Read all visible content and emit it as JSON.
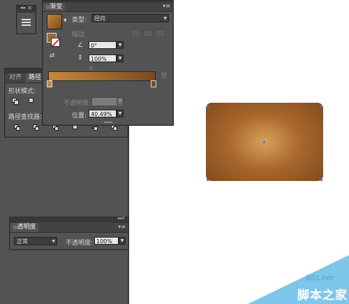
{
  "gradient_panel": {
    "title": "渐变",
    "type_label": "类型:",
    "type_value": "径向",
    "stroke_label": "描边",
    "angle_value": "0°",
    "aspect_value": "100%",
    "opacity_label": "不透明度:",
    "opacity_value": "",
    "location_label": "位置:",
    "location_value": "40.49%",
    "gradient_colors": {
      "start": "#c4883e",
      "end": "#7a4a1f"
    }
  },
  "pathfinder_panel": {
    "tab_align": "对齐",
    "tab_pathfinder": "路径",
    "shape_modes_label": "形状模式:",
    "pathfinders_label": "路径查找器:"
  },
  "transparency_panel": {
    "title": "透明度",
    "blend_mode": "正常",
    "opacity_label": "不透明度:",
    "opacity_value": "100%"
  },
  "watermark": {
    "site": "jb51.net",
    "name": "脚本之家"
  },
  "colors": {
    "panel_bg": "#535353",
    "accent_blue": "#4f7ad6",
    "shape_highlight": "#d6a25a",
    "shape_edge": "#7c4a1e"
  }
}
